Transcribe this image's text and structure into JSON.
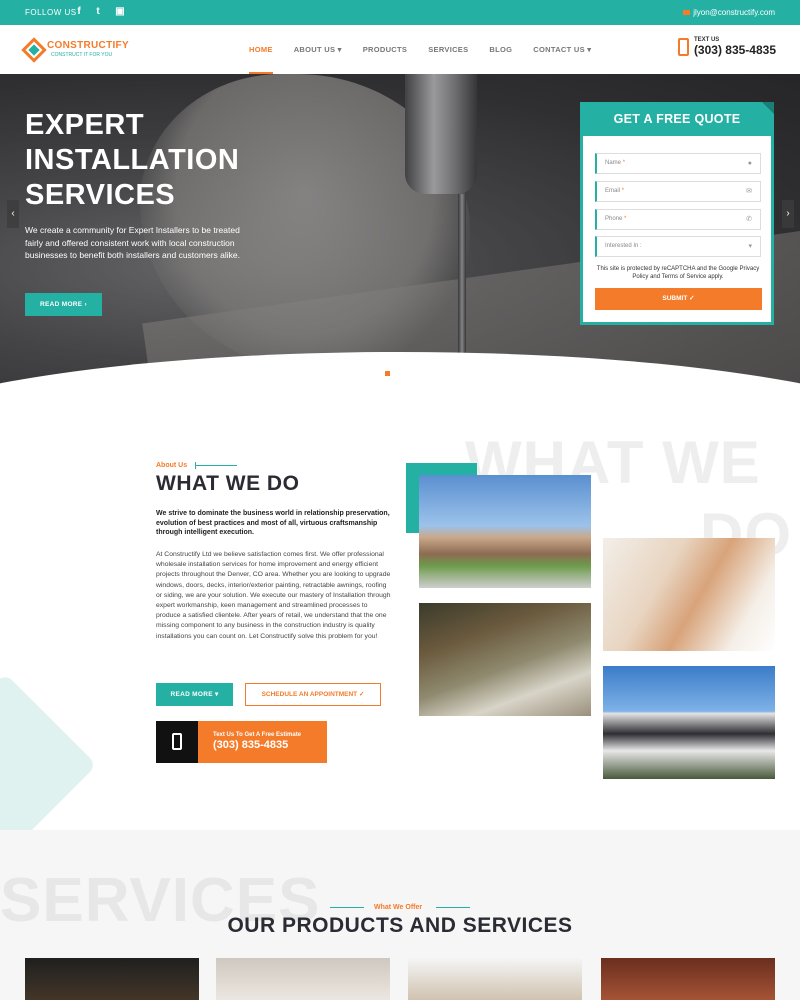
{
  "topbar": {
    "follow_label": "FOLLOW US",
    "social": [
      "f",
      "t",
      "▣"
    ],
    "email": "jlyon@constructify.com"
  },
  "nav": {
    "logo_name": "CONSTRUCTIFY",
    "logo_tagline": "CONSTRUCT IT FOR YOU",
    "items": [
      {
        "label": "HOME"
      },
      {
        "label": "ABOUT US ▾"
      },
      {
        "label": "PRODUCTS"
      },
      {
        "label": "SERVICES"
      },
      {
        "label": "BLOG"
      },
      {
        "label": "CONTACT US ▾"
      }
    ],
    "phone_label": "TEXT US",
    "phone_number": "(303) 835-4835"
  },
  "hero": {
    "title_line1": "EXPERT",
    "title_line2": "INSTALLATION",
    "title_line3": "SERVICES",
    "lead": "We create a community for Expert Installers to be treated fairly and offered consistent work with local construction businesses to benefit both installers and customers alike.",
    "button": "READ MORE ›",
    "prev_arrow": "‹",
    "next_arrow": "›"
  },
  "quote_form": {
    "title": "GET A FREE QUOTE",
    "name_placeholder": "Name",
    "email_placeholder": "Email",
    "phone_placeholder": "Phone",
    "interest_placeholder": "Interested In :",
    "required_mark": "*",
    "recaptcha_text": "This site is protected by reCAPTCHA and the Google Privacy Policy and Terms of Service apply.",
    "submit": "SUBMIT ✓"
  },
  "about": {
    "watermark_line1": "WHAT WE",
    "watermark_line2": "DO",
    "label": "About Us",
    "heading": "WHAT WE DO",
    "intro": "We strive to dominate the business world in relationship preservation, evolution of best practices and most of all, virtuous craftsmanship through intelligent execution.",
    "body": "At Constructify Ltd we believe satisfaction comes first. We offer professional wholesale installation services for home improvement and energy efficient projects throughout the Denver, CO area. Whether you are looking to upgrade windows, doors, decks, interior/exterior painting, retractable awnings, roofing or siding, we are your solution. We execute our mastery of Installation through expert workmanship, keen management and streamlined processes to produce a satisfied clientele. After years of retail, we understand that the one missing component to any business in the construction industry is quality installations you can count on. Let Constructify solve this problem for you!",
    "read_more": "READ MORE ▾",
    "schedule": "SCHEDULE AN APPOINTMENT ✓",
    "cta_small": "Text Us To Get A Free Estimate",
    "cta_number": "(303) 835-4835"
  },
  "services": {
    "watermark": "SERVICES",
    "label": "What We Offer",
    "heading": "OUR PRODUCTS AND SERVICES"
  }
}
